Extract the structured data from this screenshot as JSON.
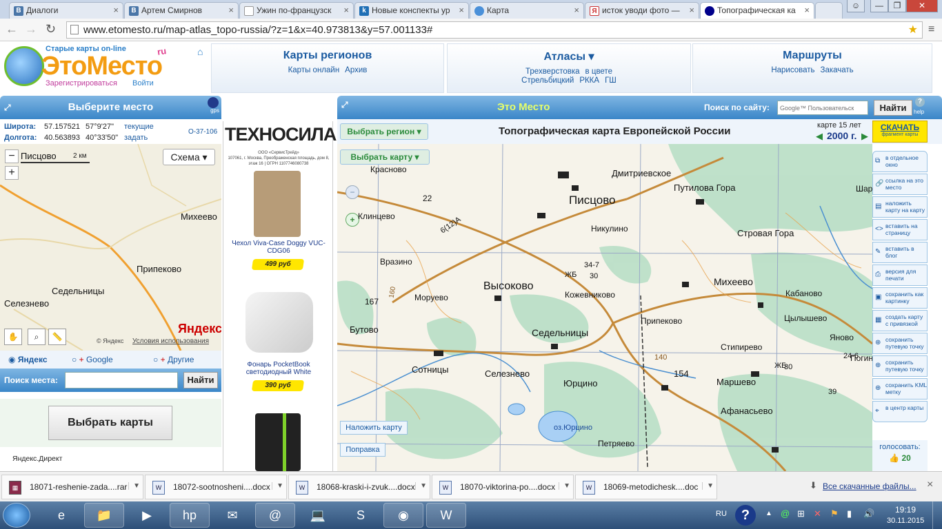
{
  "tabs": [
    {
      "label": "Диалоги",
      "icon": "vk-icon"
    },
    {
      "label": "Артем Смирнов",
      "icon": "vk-icon"
    },
    {
      "label": "Ужин по-французск",
      "icon": "page-icon"
    },
    {
      "label": "Новые конспекты ур",
      "icon": "k-icon"
    },
    {
      "label": "Карта",
      "icon": "globe-icon"
    },
    {
      "label": "исток уводи фото —",
      "icon": "yandex-icon"
    },
    {
      "label": "Топографическая ка",
      "icon": "globe-icon"
    }
  ],
  "browser": {
    "url": "www.etomesto.ru/map-atlas_topo-russia/?z=1&x=40.973813&y=57.001133#"
  },
  "site": {
    "logo_text": "ЭтоМесто",
    "logo_badge": "ru",
    "logo_tagline": "Старые карты on-line",
    "register": "Зарегистрироваться",
    "login": "Войти"
  },
  "nav": [
    {
      "title": "Карты регионов",
      "links": [
        "Карты онлайн",
        "Архив"
      ]
    },
    {
      "title": "Атласы ▾",
      "links": [
        "Трехверстовка",
        "в цвете",
        "Стрельбицкий",
        "РККА",
        "ГШ"
      ]
    },
    {
      "title": "Маршруты",
      "links": [
        "Нарисовать",
        "Закачать"
      ]
    }
  ],
  "left": {
    "title": "Выберите место",
    "gps": "gps",
    "lat_label": "Широта:",
    "lat_dec": "57.157521",
    "lat_dms": "57°9'27\"",
    "lon_label": "Долгота:",
    "lon_dec": "40.563893",
    "lon_dms": "40°33'50\"",
    "current": "текущие",
    "set": "задать",
    "sheet": "O-37-106",
    "scale_label": "2 км",
    "scheme": "Схема ▾",
    "copyright": "© Яндекс",
    "terms": "Условия использования",
    "yandex_logo": "Яндекс",
    "providers": [
      "Яндекс",
      "Google",
      "Другие"
    ],
    "search_label": "Поиск места:",
    "search_btn": "Найти",
    "choose_maps": "Выбрать карты",
    "direct": "Яндекс.Директ",
    "map_places": [
      "Писцово",
      "Михеево",
      "Припеково",
      "Седельницы",
      "Селезнево"
    ]
  },
  "ad": {
    "brand": "ТЕХНОСИЛА",
    "company": "ООО «СервисТрейд»",
    "address": "107061, г. Москва, Преображенская площадь, дом 8, этаж 16 | ОГРН 1107746080738",
    "items": [
      {
        "name": "Чехол Viva-Case Doggy VUC-CDG06",
        "price": "499 руб"
      },
      {
        "name": "Фонарь PocketBook светодиодный White",
        "price": "390 руб"
      }
    ]
  },
  "map": {
    "brand": "Это Место",
    "search_label": "Поиск по сайту:",
    "search_placeholder": "Google™ Пользовательск",
    "search_btn": "Найти",
    "help": "help",
    "region_btn": "Выбрать регион ▾",
    "title": "Топографическая карта Европейской России",
    "age_label": "карте 15 лет",
    "year": "2000 г.",
    "download": "СКАЧАТЬ",
    "download_sub": "фрагмент карты",
    "choose_map": "Выбрать карту ▾",
    "overlay_btn": "Наложить карту",
    "correction_btn": "Поправка",
    "vote_label": "голосовать:",
    "vote_count": "20",
    "side_buttons": [
      "в отдельное окно",
      "ссылка на это место",
      "наложить карту на карту",
      "вставить на страницу",
      "вставить в блог",
      "версия для печати",
      "сохранить как картинку",
      "создать карту с привязкой",
      "сохранить путевую точку",
      "сохранить путевую точку",
      "сохранить KML метку",
      "в центр карты"
    ],
    "places": [
      "Красново",
      "Дмитриевское",
      "Путилова Гора",
      "Писцово",
      "Шара",
      "Клинцево",
      "Никулино",
      "Стровая Гора",
      "Вразино",
      "Высоково",
      "Кожевниково",
      "Михеево",
      "Кабаново",
      "Моруево",
      "Цылышево",
      "Бутово",
      "Седельницы",
      "Припеково",
      "Стипирево",
      "Яново",
      "Сотницы",
      "Селезнево",
      "Юрцино",
      "Маршево",
      "Погино",
      "Афанасьево",
      "Петряево",
      "оз.Юрцино"
    ],
    "numbers": [
      "22",
      "167",
      "160",
      "34-7",
      "ЖБ",
      "30",
      "154",
      "140",
      "24-6",
      "30",
      "ЖБ",
      "39"
    ],
    "road": "6(12)А"
  },
  "downloads": [
    {
      "name": "18071-reshenie-zada....rar",
      "type": "rar"
    },
    {
      "name": "18072-sootnosheni....docx",
      "type": "docx"
    },
    {
      "name": "18068-kraski-i-zvuk....docx",
      "type": "docx"
    },
    {
      "name": "18070-viktorina-po....docx",
      "type": "docx"
    },
    {
      "name": "18069-metodichesk....doc",
      "type": "doc"
    }
  ],
  "all_downloads": "Все скачанные файлы...",
  "taskbar": {
    "lang": "RU",
    "time": "19:19",
    "date": "30.11.2015"
  }
}
